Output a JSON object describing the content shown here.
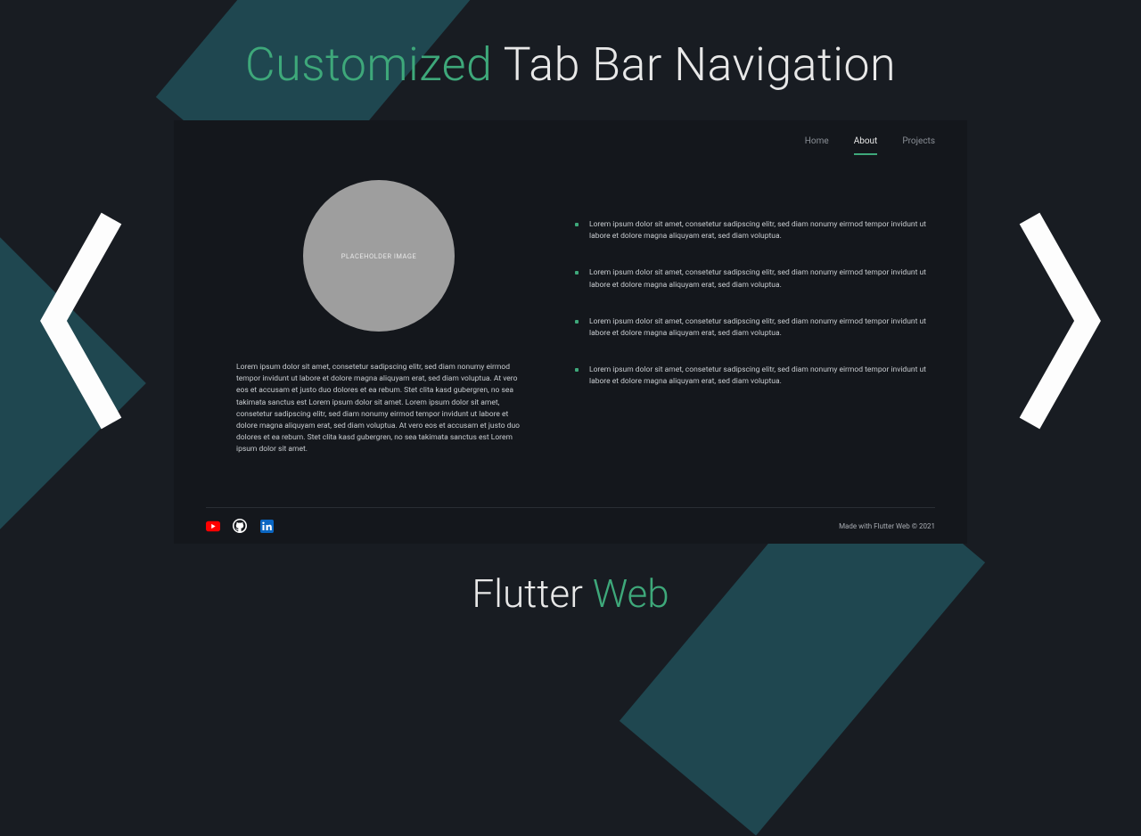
{
  "title_top": {
    "accent": "Customized",
    "rest": "Tab Bar Navigation"
  },
  "title_bottom": {
    "main": "Flutter",
    "accent": "Web"
  },
  "tabs": [
    {
      "label": "Home",
      "active": false
    },
    {
      "label": "About",
      "active": true
    },
    {
      "label": "Projects",
      "active": false
    }
  ],
  "placeholder_label": "PLACEHOLDER IMAGE",
  "left_paragraph": "Lorem ipsum dolor sit amet, consetetur sadipscing elitr, sed diam nonumy eirmod tempor invidunt ut labore et dolore magna aliquyam erat, sed diam voluptua. At vero eos et accusam et justo duo dolores et ea rebum. Stet clita kasd gubergren, no sea takimata sanctus est Lorem ipsum dolor sit amet. Lorem ipsum dolor sit amet, consetetur sadipscing elitr, sed diam nonumy eirmod tempor invidunt ut labore et dolore magna aliquyam erat, sed diam voluptua. At vero eos et accusam et justo duo dolores et ea rebum. Stet clita kasd gubergren, no sea takimata sanctus est Lorem ipsum dolor sit amet.",
  "bullets": [
    "Lorem ipsum dolor sit amet, consetetur sadipscing elitr, sed diam nonumy eirmod tempor invidunt ut labore et dolore magna aliquyam erat, sed diam voluptua.",
    "Lorem ipsum dolor sit amet, consetetur sadipscing elitr, sed diam nonumy eirmod tempor invidunt ut labore et dolore magna aliquyam erat, sed diam voluptua.",
    "Lorem ipsum dolor sit amet, consetetur sadipscing elitr, sed diam nonumy eirmod tempor invidunt ut labore et dolore magna aliquyam erat, sed diam voluptua.",
    "Lorem ipsum dolor sit amet, consetetur sadipscing elitr, sed diam nonumy eirmod tempor invidunt ut labore et dolore magna aliquyam erat, sed diam voluptua."
  ],
  "footer_text": "Made with Flutter Web © 2021",
  "colors": {
    "accent": "#3ea87a",
    "bg": "#181c22",
    "panel": "#14171c"
  }
}
